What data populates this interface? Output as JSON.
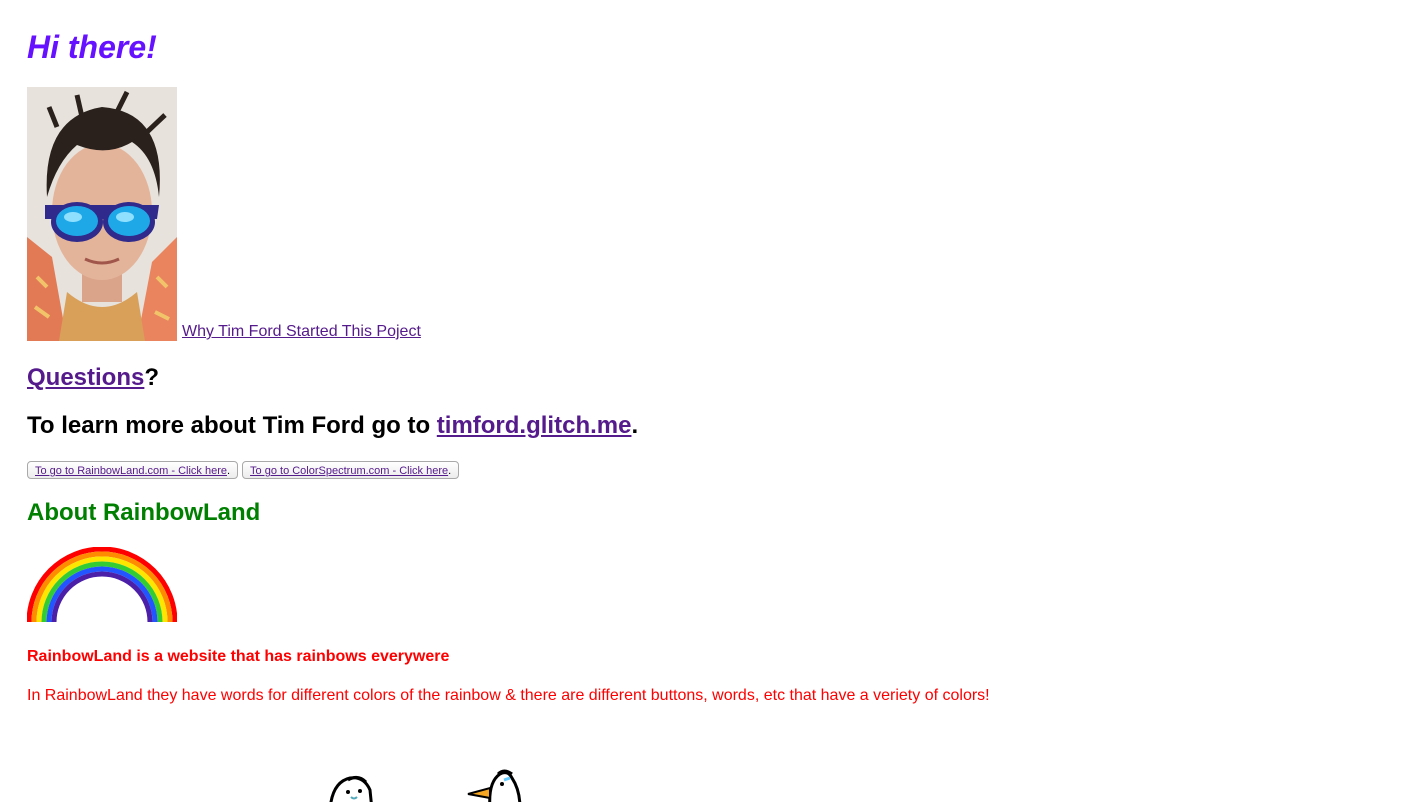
{
  "greeting": "Hi there!",
  "profile": {
    "photo_alt": "Tim Ford photo",
    "why_link": "Why Tim Ford Started This Poject"
  },
  "questions": {
    "link": "Questions",
    "suffix": "?"
  },
  "learn_more": {
    "prefix": "To learn more about Tim Ford go to ",
    "link": "timford.glitch.me",
    "suffix": "."
  },
  "buttons": [
    {
      "link": "To go to RainbowLand.com - Click here",
      "suffix": "."
    },
    {
      "link": "To go to ColorSpectrum.com - Click here",
      "suffix": "."
    }
  ],
  "about": {
    "heading": "About RainbowLand",
    "tagline": "RainbowLand is a website that has rainbows everywere",
    "description": "In RainbowLand they have words for different colors of the rainbow & there are different buttons, words, etc that have a veriety of colors!"
  },
  "colors": {
    "greeting": "#6611ff",
    "link_visited": "#551a8b",
    "about_heading": "#008000",
    "about_text": "#ff0000"
  },
  "icons": {
    "rainbow": "rainbow-icon",
    "penguins": [
      "penguin-icon",
      "penguin-icon"
    ]
  }
}
